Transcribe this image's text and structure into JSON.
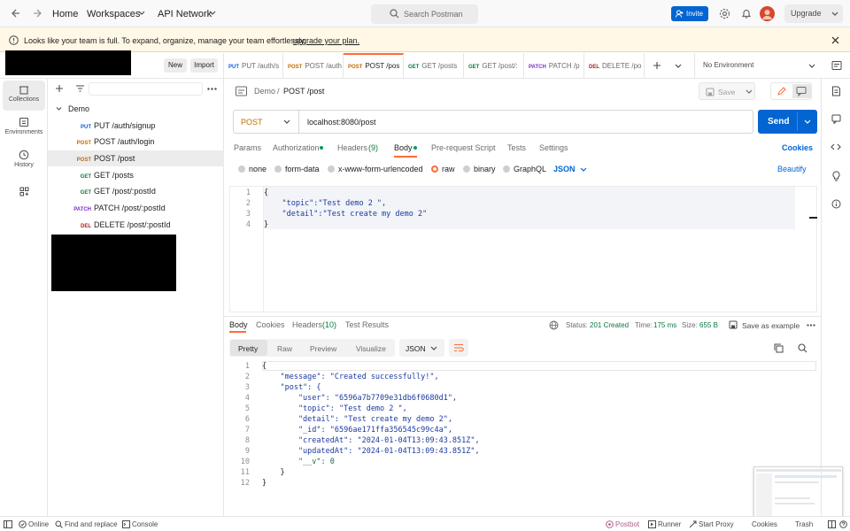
{
  "colors": {
    "brand": "#ff6c37",
    "send": "#0265d2",
    "invite": "#0265d2",
    "banner": "#fff8e6"
  },
  "topbar": {
    "home": "Home",
    "workspaces": "Workspaces",
    "api_network": "API Network",
    "search_placeholder": "Search Postman",
    "invite": "Invite",
    "upgrade": "Upgrade"
  },
  "banner": {
    "text": "Looks like your team is full. To expand, organize, manage your team effortlessly,",
    "link": "upgrade your plan."
  },
  "sidebar": {
    "new": "New",
    "import": "Import",
    "rail": [
      "Collections",
      "Environments",
      "History"
    ],
    "collection": "Demo",
    "items": [
      {
        "method": "PUT",
        "name": "PUT /auth/signup"
      },
      {
        "method": "POST",
        "name": "POST /auth/login"
      },
      {
        "method": "POST",
        "name": "POST /post"
      },
      {
        "method": "GET",
        "name": "GET /posts"
      },
      {
        "method": "GET",
        "name": "GET /post/:postId"
      },
      {
        "method": "PATCH",
        "name": "PATCH /post/:postId"
      },
      {
        "method": "DEL",
        "name": "DELETE /post/:postId"
      }
    ]
  },
  "tabs": [
    {
      "method": "PUT",
      "name": "PUT /auth/s"
    },
    {
      "method": "POST",
      "name": "POST /auth"
    },
    {
      "method": "POST",
      "name": "POST /pos"
    },
    {
      "method": "GET",
      "name": "GET /posts"
    },
    {
      "method": "GET",
      "name": "GET /post/:"
    },
    {
      "method": "PATCH",
      "name": "PATCH /p"
    },
    {
      "method": "DEL",
      "name": "DELETE /po"
    }
  ],
  "environment": "No Environment",
  "request": {
    "breadcrumb_parent": "Demo",
    "breadcrumb_sep": "/",
    "breadcrumb_current": "POST /post",
    "save": "Save",
    "method": "POST",
    "url": "localhost:8080/post",
    "send": "Send",
    "subtabs": [
      "Params",
      "Authorization",
      "Headers",
      "Body",
      "Pre-request Script",
      "Tests",
      "Settings"
    ],
    "headers_count": "(9)",
    "cookies": "Cookies",
    "body_types": [
      "none",
      "form-data",
      "x-www-form-urlencoded",
      "raw",
      "binary",
      "GraphQL"
    ],
    "format": "JSON",
    "beautify": "Beautify",
    "body_lines": [
      "{",
      "    \"topic\":\"Test demo 2 \",",
      "    \"detail\":\"Test create my demo 2\"",
      "}"
    ]
  },
  "response": {
    "tabs": [
      "Body",
      "Cookies",
      "Headers",
      "Test Results"
    ],
    "headers_count": "(10)",
    "status_label": "Status:",
    "status": "201 Created",
    "time_label": "Time:",
    "time": "175 ms",
    "size_label": "Size:",
    "size": "655 B",
    "save_example": "Save as example",
    "views": [
      "Pretty",
      "Raw",
      "Preview",
      "Visualize"
    ],
    "format": "JSON",
    "lines": [
      "{",
      "    \"message\": \"Created successfully!\",",
      "    \"post\": {",
      "        \"user\": \"6596a7b7709e31db6f0680d1\",",
      "        \"topic\": \"Test demo 2 \",",
      "        \"detail\": \"Test create my demo 2\",",
      "        \"_id\": \"6596ae171ffa356545c99c4a\",",
      "        \"createdAt\": \"2024-01-04T13:09:43.851Z\",",
      "        \"updatedAt\": \"2024-01-04T13:09:43.851Z\",",
      "        \"__v\": 0",
      "    }",
      "}"
    ]
  },
  "statusbar": {
    "online": "Online",
    "find": "Find and replace",
    "console": "Console",
    "postbot": "Postbot",
    "runner": "Runner",
    "proxy": "Start Proxy",
    "cookies": "Cookies",
    "trash": "Trash"
  }
}
